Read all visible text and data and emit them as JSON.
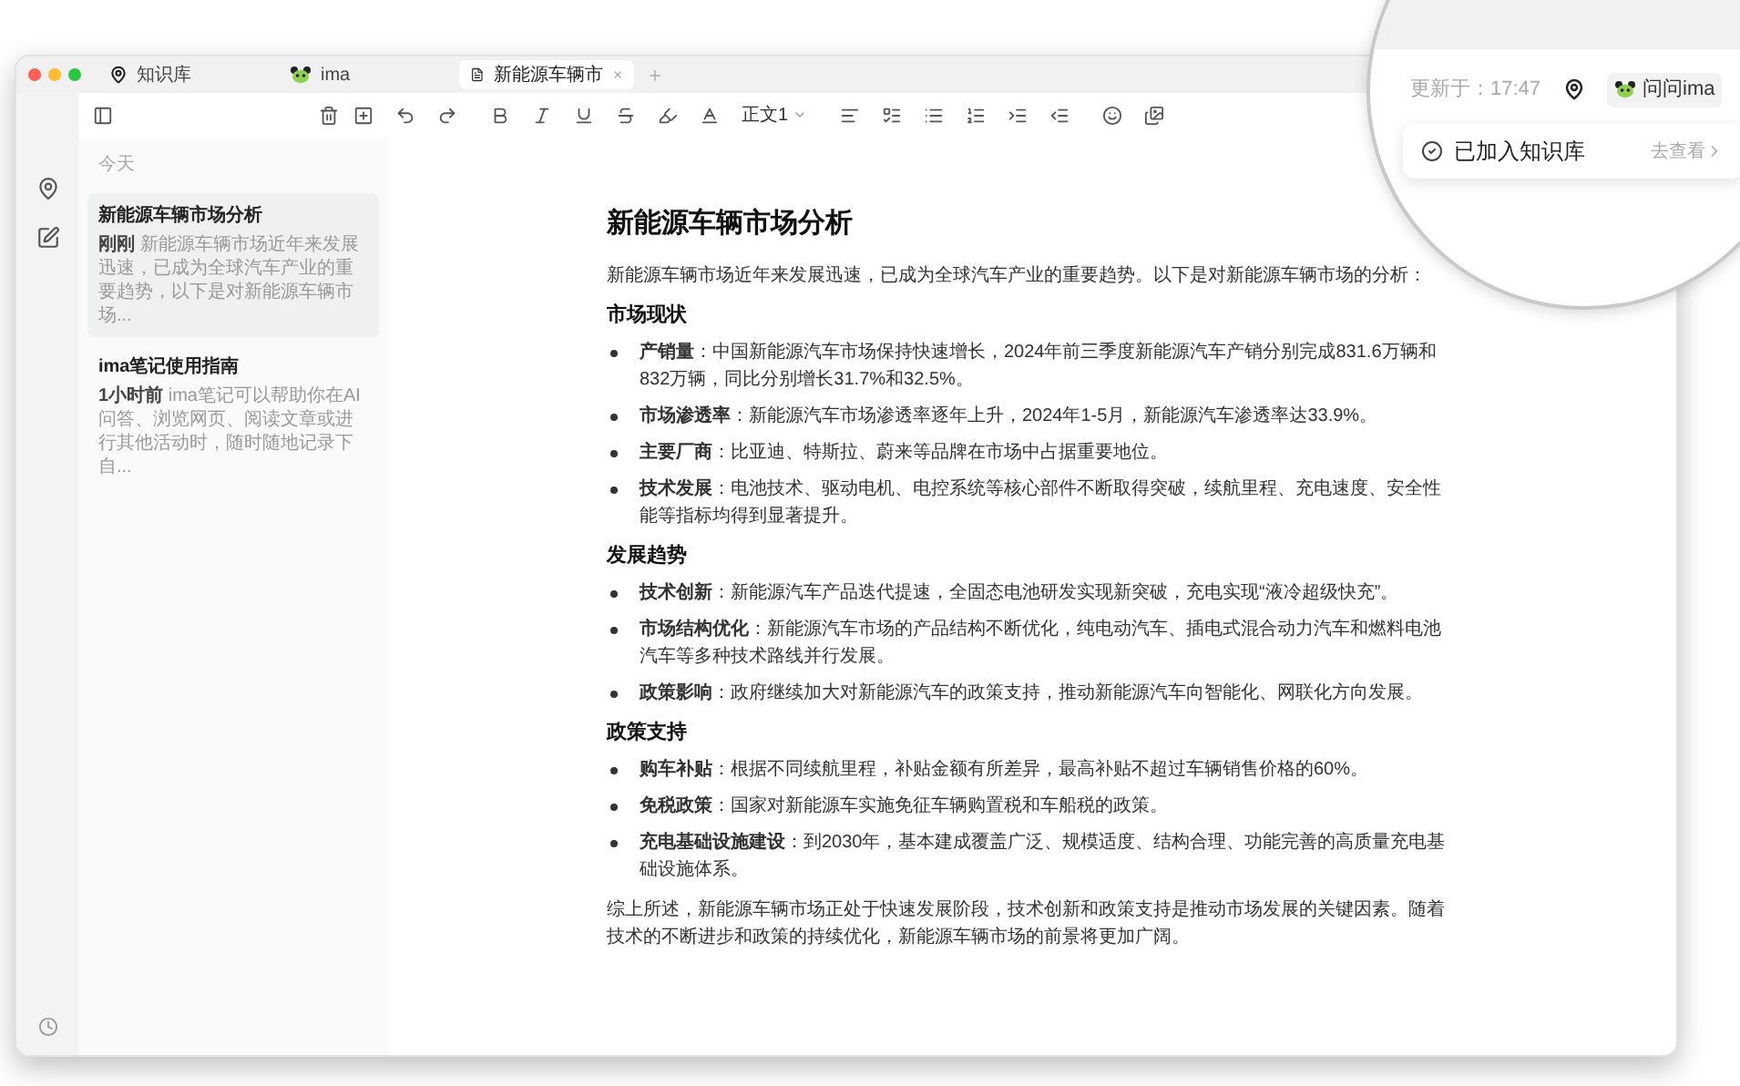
{
  "tabs": [
    {
      "label": "知识库",
      "selected": false
    },
    {
      "label": "ima",
      "selected": false
    },
    {
      "label": "新能源车辆市",
      "selected": true
    }
  ],
  "toolbar": {
    "style_label": "正文1"
  },
  "sidebar": {
    "section": "今天",
    "notes": [
      {
        "title": "新能源车辆市场分析",
        "time": "刚刚",
        "preview": "新能源车辆市场近年来发展迅速，已成为全球汽车产业的重要趋势，以下是对新能源车辆市场...",
        "selected": true
      },
      {
        "title": "ima笔记使用指南",
        "time": "1小时前",
        "preview": "ima笔记可以帮助你在AI问答、浏览网页、阅读文章或进行其他活动时，随时随地记录下自...",
        "selected": false
      }
    ]
  },
  "document": {
    "title": "新能源车辆市场分析",
    "intro": "新能源车辆市场近年来发展迅速，已成为全球汽车产业的重要趋势。以下是对新能源车辆市场的分析：",
    "sections": [
      {
        "heading": "市场现状",
        "bullets": [
          "**产销量**：中国新能源汽车市场保持快速增长，2024年前三季度新能源汽车产销分别完成831.6万辆和832万辆，同比分别增长31.7%和32.5%。",
          "**市场渗透率**：新能源汽车市场渗透率逐年上升，2024年1-5月，新能源汽车渗透率达33.9%。",
          "**主要厂商**：比亚迪、特斯拉、蔚来等品牌在市场中占据重要地位。",
          "**技术发展**：电池技术、驱动电机、电控系统等核心部件不断取得突破，续航里程、充电速度、安全性能等指标均得到显著提升。"
        ]
      },
      {
        "heading": "发展趋势",
        "bullets": [
          "**技术创新**：新能源汽车产品迭代提速，全固态电池研发实现新突破，充电实现“液冷超级快充”。",
          "**市场结构优化**：新能源汽车市场的产品结构不断优化，纯电动汽车、插电式混合动力汽车和燃料电池汽车等多种技术路线并行发展。",
          "**政策影响**：政府继续加大对新能源汽车的政策支持，推动新能源汽车向智能化、网联化方向发展。"
        ]
      },
      {
        "heading": "政策支持",
        "bullets": [
          "**购车补贴**：根据不同续航里程，补贴金额有所差异，最高补贴不超过车辆销售价格的60%。",
          "**免税政策**：国家对新能源车实施免征车辆购置税和车船税的政策。",
          "**充电基础设施建设**：到2030年，基本建成覆盖广泛、规模适度、结构合理、功能完善的高质量充电基础设施体系。"
        ]
      }
    ],
    "conclusion": "综上所述，新能源车辆市场正处于快速发展阶段，技术创新和政策支持是推动市场发展的关键因素。随着技术的不断进步和政策的持续优化，新能源车辆市场的前景将更加广阔。"
  },
  "magnifier": {
    "updated": "更新于：17:47",
    "ask_button": "问问ima",
    "toast": {
      "message": "已加入知识库",
      "link": "去查看"
    }
  }
}
